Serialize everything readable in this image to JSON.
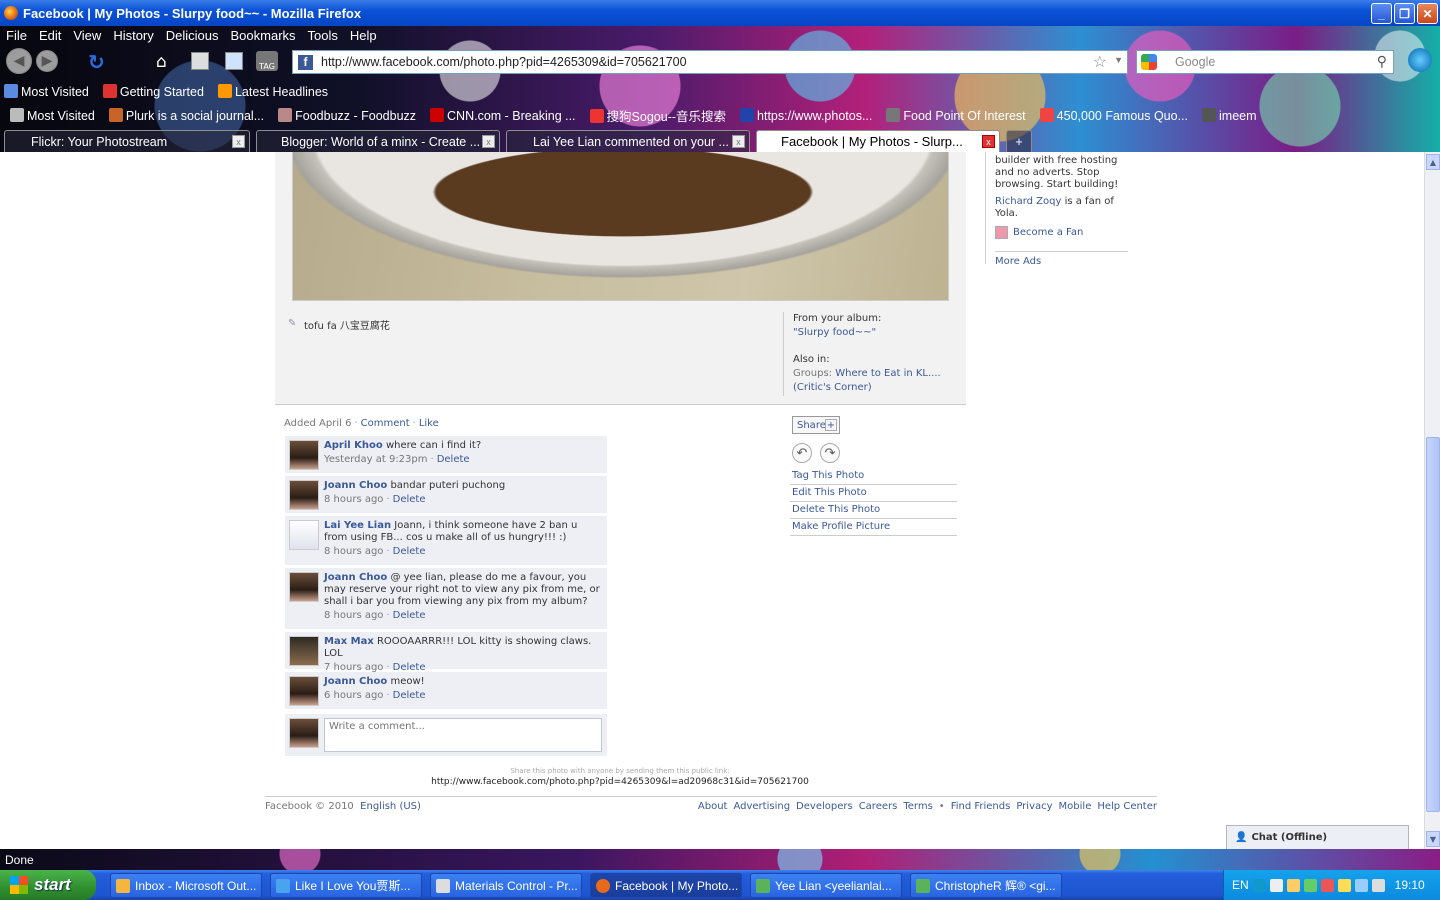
{
  "window": {
    "title": "Facebook | My Photos - Slurpy food~~ - Mozilla Firefox",
    "min": "_",
    "max": "❐",
    "close": "✕"
  },
  "menu": [
    "File",
    "Edit",
    "View",
    "History",
    "Delicious",
    "Bookmarks",
    "Tools",
    "Help"
  ],
  "nav": {
    "url": "http://www.facebook.com/photo.php?pid=4265309&id=705621700",
    "search_placeholder": "Google",
    "fav": "f",
    "star": "☆"
  },
  "bookmarks1": [
    "Most Visited",
    "Getting Started",
    "Latest Headlines"
  ],
  "bookmarks2": [
    "Most Visited",
    "Plurk is a social journal...",
    "Foodbuzz - Foodbuzz",
    "CNN.com - Breaking ...",
    "搜狗Sogou--音乐搜索",
    "https://www.photos...",
    "Food Point Of Interest",
    "450,000 Famous Quo...",
    "imeem"
  ],
  "tabs": [
    "Flickr: Your Photostream",
    "Blogger: World of a minx - Create ...",
    "Lai Yee Lian commented on your ...",
    "Facebook | My Photos - Slurp..."
  ],
  "photo": {
    "caption": "tofu fa 八宝豆腐花",
    "from_album_label": "From your album:",
    "album": "\"Slurpy food~~\"",
    "also_in": "Also in:",
    "groups_label": "Groups:",
    "group_name": "Where to Eat in KL....",
    "group_name2": "(Critic's Corner)"
  },
  "added": {
    "text": "Added April 6",
    "comment": "Comment",
    "like": "Like"
  },
  "comments": [
    {
      "name": "April Khoo",
      "text": "where can i find it?",
      "time": "Yesterday at 9:23pm",
      "delete": "Delete"
    },
    {
      "name": "Joann Choo",
      "text": "bandar puteri puchong",
      "time": "8 hours ago",
      "delete": "Delete"
    },
    {
      "name": "Lai Yee Lian",
      "text": "Joann, i think someone have 2 ban u from using FB... cos u make all of us hungry!!! :)",
      "time": "8 hours ago",
      "delete": "Delete"
    },
    {
      "name": "Joann Choo",
      "text": "@ yee lian, please do me a favour, you may reserve your right not to view any pix from me, or shall i bar you from viewing any pix from my album?",
      "time": "8 hours ago",
      "delete": "Delete"
    },
    {
      "name": "Мах Мах",
      "text": "ROOOAARRR!!! LOL kitty is showing claws. LOL",
      "time": "7 hours ago",
      "delete": "Delete"
    },
    {
      "name": "Joann Choo",
      "text": "meow!",
      "time": "6 hours ago",
      "delete": "Delete"
    }
  ],
  "write_comment": "Write a comment...",
  "share": {
    "label": "Share",
    "plus": "+"
  },
  "actions": [
    "Tag This Photo",
    "Edit This Photo",
    "Delete This Photo",
    "Make Profile Picture"
  ],
  "ads": {
    "text": "builder with free hosting and no adverts. Stop browsing. Start building!",
    "fan_name": "Richard Zoqy",
    "fan_text": "is a fan of Yola.",
    "become_fan": "Become a Fan",
    "more_ads": "More Ads"
  },
  "sharelink": {
    "hint": "Share this photo with anyone by sending them this public link:",
    "url": "http://www.facebook.com/photo.php?pid=4265309&l=ad20968c31&id=705621700"
  },
  "footer": {
    "copyright": "Facebook © 2010",
    "language": "English (US)",
    "links": [
      "About",
      "Advertising",
      "Developers",
      "Careers",
      "Terms",
      "•",
      "Find Friends",
      "Privacy",
      "Mobile",
      "Help Center"
    ]
  },
  "chat": "Chat (Offline)",
  "status": "Done",
  "taskbar": {
    "start": "start",
    "tasks": [
      "Inbox - Microsoft Out...",
      "Like I Love You贾斯...",
      "Materials Control - Pr...",
      "Facebook | My Photo...",
      "Yee Lian <yeelianlai...",
      "ChristopheR 辉® <gi..."
    ],
    "lang": "EN",
    "time": "19:10"
  }
}
